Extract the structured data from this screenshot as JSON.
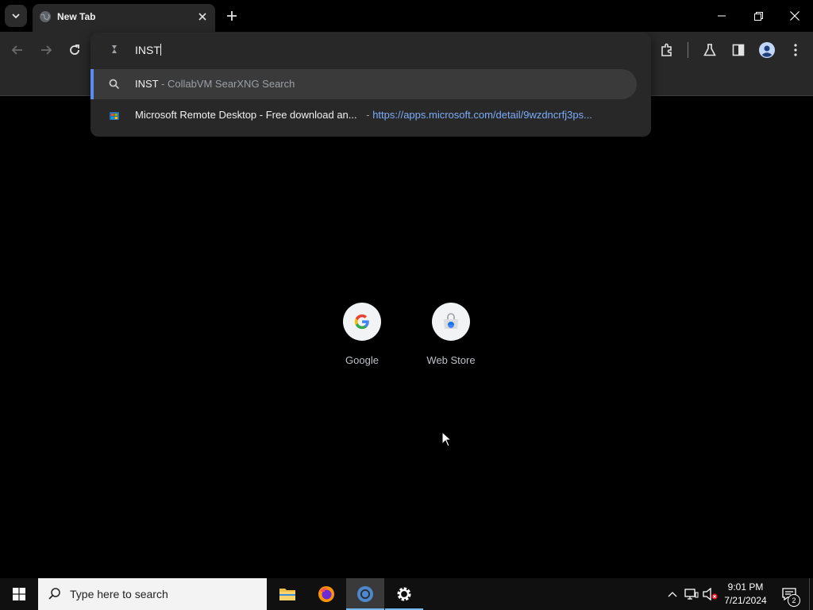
{
  "browser": {
    "tab": {
      "title": "New Tab",
      "favicon": "globe-icon"
    },
    "toolbar": {
      "back": "arrow-left-icon",
      "forward": "arrow-right-icon",
      "reload": "reload-icon",
      "extensions": "puzzle-icon",
      "labs": "flask-icon",
      "side_panel": "side-panel-icon",
      "profile": "profile-icon",
      "menu": "more-vert-icon"
    },
    "omnibox": {
      "value": "INST",
      "suggestions": [
        {
          "main": "INST",
          "separator": " - ",
          "desc": "CollabVM SearXNG Search",
          "icon": "search-icon"
        },
        {
          "main": "Microsoft Remote Desktop - Free download an...",
          "separator": " - ",
          "url": "https://apps.microsoft.com/detail/9wzdncrfj3ps...",
          "icon": "store-icon"
        }
      ]
    }
  },
  "shortcuts": [
    {
      "label": "Google",
      "icon": "google-icon"
    },
    {
      "label": "Web Store",
      "icon": "web-store-icon"
    }
  ],
  "taskbar": {
    "search_placeholder": "Type here to search",
    "apps": [
      "file-explorer-icon",
      "firefox-icon",
      "chrome-icon",
      "settings-icon"
    ],
    "clock_time": "9:01 PM",
    "clock_date": "7/21/2024",
    "notification_count": "2"
  },
  "colors": {
    "accent": "#5b8def",
    "url": "#7cacf8",
    "taskbar_active": "#76b9ed"
  }
}
